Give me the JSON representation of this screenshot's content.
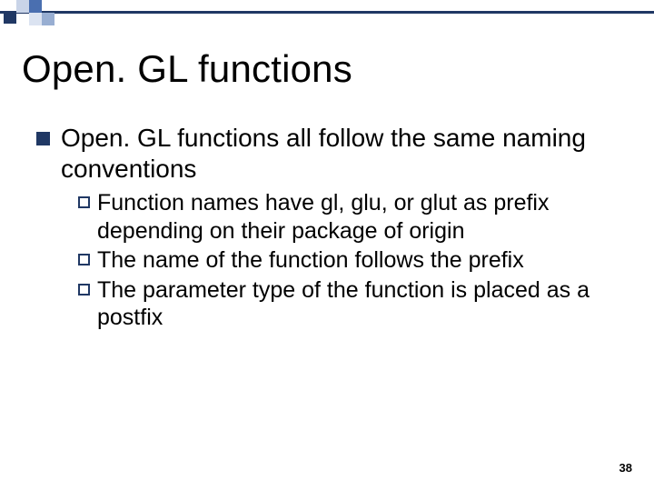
{
  "title": "Open. GL functions",
  "bullets": [
    {
      "text": "Open. GL functions all follow the same naming conventions",
      "children": [
        {
          "lead": "Function",
          "rest": " names have gl, glu, or glut as prefix depending on their package of origin"
        },
        {
          "lead": "The",
          "rest": " name of the function follows the prefix"
        },
        {
          "lead": "The",
          "rest": " parameter type of the function is placed as a postfix"
        }
      ]
    }
  ],
  "page_number": "38"
}
